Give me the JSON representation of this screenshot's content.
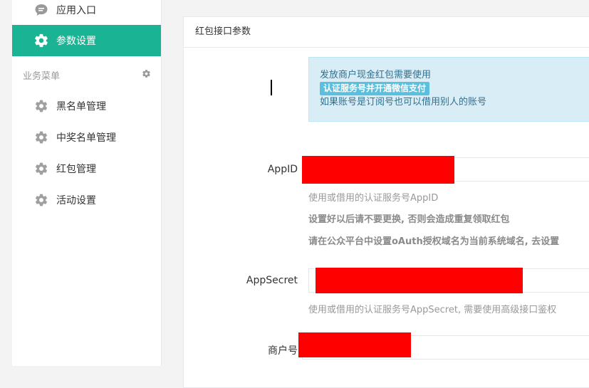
{
  "sidebar": {
    "top_items": [
      {
        "label": "应用入口",
        "icon": "chat-bubble-icon",
        "active": false
      },
      {
        "label": "参数设置",
        "icon": "gear-icon",
        "active": true
      }
    ],
    "section_title": "业务菜单",
    "section_items": [
      {
        "label": "黑名单管理",
        "icon": "gear-icon"
      },
      {
        "label": "中奖名单管理",
        "icon": "gear-icon"
      },
      {
        "label": "红包管理",
        "icon": "gear-icon"
      },
      {
        "label": "活动设置",
        "icon": "gear-icon"
      }
    ]
  },
  "panel": {
    "title": "红包接口参数",
    "alert": {
      "line1": "发放商户现金红包需要使用",
      "badge": "认证服务号并开通微信支付",
      "line3": "如果账号是订阅号也可以借用别人的账号"
    },
    "fields": {
      "appid": {
        "label": "AppID",
        "help1": "使用或借用的认证服务号AppID",
        "help2": "设置好以后请不要更换, 否则会造成重复领取红包",
        "help3": "请在公众平台中设置oAuth授权域名为当前系统域名, 去设置"
      },
      "appsecret": {
        "label": "AppSecret",
        "help1": "使用或借用的认证服务号AppSecret, 需要使用高级接口鉴权"
      },
      "merchant": {
        "label": "商户号"
      }
    }
  },
  "colors": {
    "accent": "#1ab394",
    "alert_bg": "#d9edf7",
    "alert_badge": "#5bc0de",
    "redaction": "#ff0000"
  }
}
